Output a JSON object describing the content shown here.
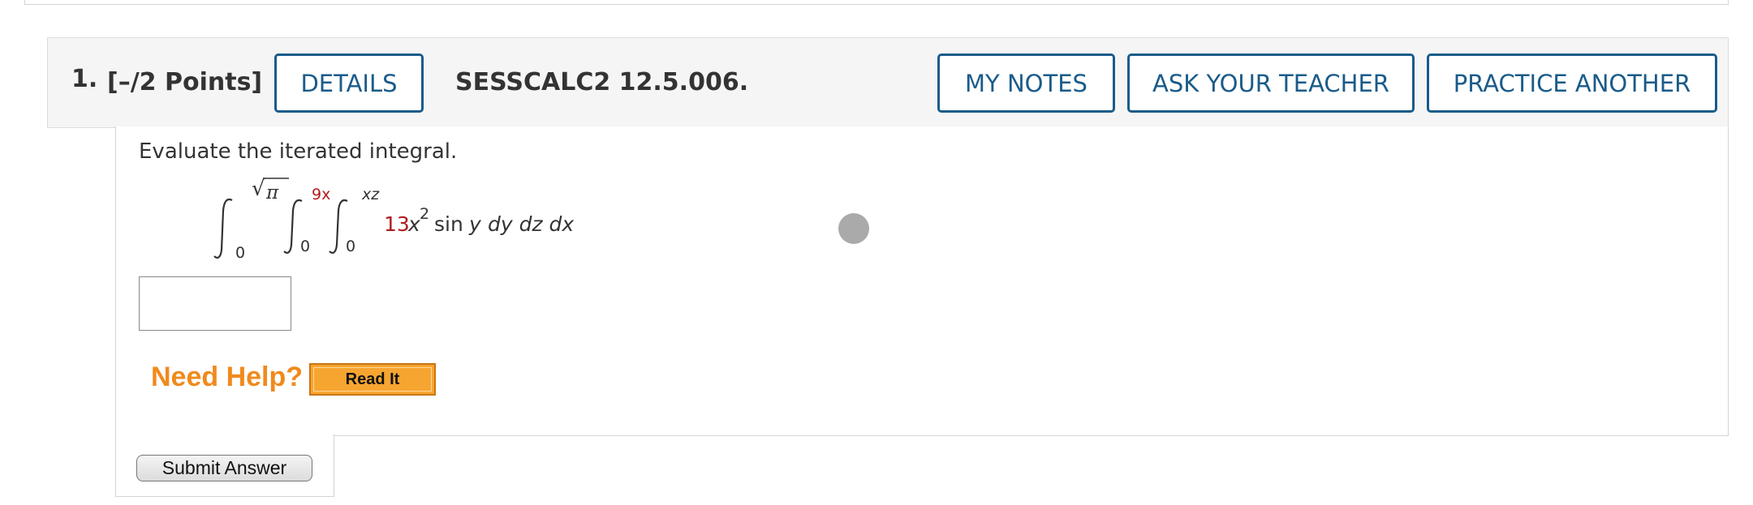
{
  "question": {
    "number": "1.",
    "points": "[–/2 Points]",
    "code": "SESSCALC2 12.5.006."
  },
  "header_buttons": {
    "details": "DETAILS",
    "my_notes": "MY NOTES",
    "ask_teacher": "ASK YOUR TEACHER",
    "practice_another": "PRACTICE ANOTHER"
  },
  "body": {
    "prompt": "Evaluate the iterated integral.",
    "integral": {
      "outer": {
        "lower": "0",
        "upper_radicand": "π",
        "upper_radical": "√"
      },
      "middle": {
        "lower": "0",
        "upper": "9x"
      },
      "inner": {
        "lower": "0",
        "upper": "xz"
      },
      "coefficient": "13",
      "variable": "x",
      "exponent": "2",
      "function": "sin",
      "function_arg": "y",
      "differentials": "dy dz dx"
    },
    "answer_value": ""
  },
  "help": {
    "label": "Need Help?",
    "read_it": "Read It"
  },
  "submit": {
    "label": "Submit Answer"
  },
  "colors": {
    "button_border": "#1a5b8a",
    "highlight_red": "#b01c1c",
    "need_help_orange": "#f08a1c",
    "read_it_fill": "#f7a531"
  }
}
